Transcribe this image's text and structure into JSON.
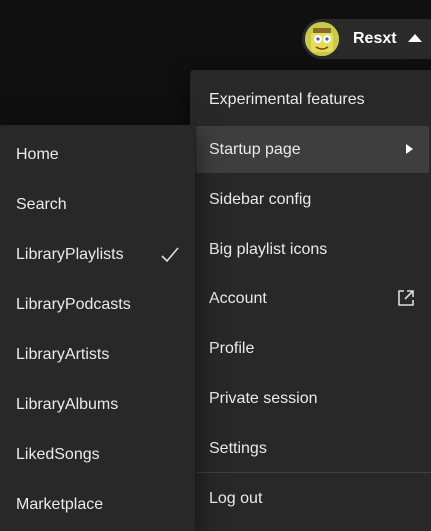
{
  "user": {
    "name": "Resxt",
    "avatar_icon": "avatar-image"
  },
  "menu": {
    "items": [
      {
        "label": "Experimental features"
      },
      {
        "label": "Startup page",
        "submenu_arrow": "chevron-right-icon"
      },
      {
        "label": "Sidebar config"
      },
      {
        "label": "Big playlist icons"
      },
      {
        "label": "Account",
        "trailing_icon": "external-link-icon"
      },
      {
        "label": "Profile"
      },
      {
        "label": "Private session"
      },
      {
        "label": "Settings"
      },
      {
        "label": "Log out"
      }
    ],
    "active_index": 1
  },
  "submenu": {
    "items": [
      {
        "label": "Home"
      },
      {
        "label": "Search"
      },
      {
        "label": "LibraryPlaylists",
        "checked": true
      },
      {
        "label": "LibraryPodcasts"
      },
      {
        "label": "LibraryArtists"
      },
      {
        "label": "LibraryAlbums"
      },
      {
        "label": "LikedSongs"
      },
      {
        "label": "Marketplace"
      }
    ]
  },
  "colors": {
    "background": "#121212",
    "menu_bg": "#282828",
    "active_bg": "#3e3e3e",
    "text": "#eaeaea"
  }
}
